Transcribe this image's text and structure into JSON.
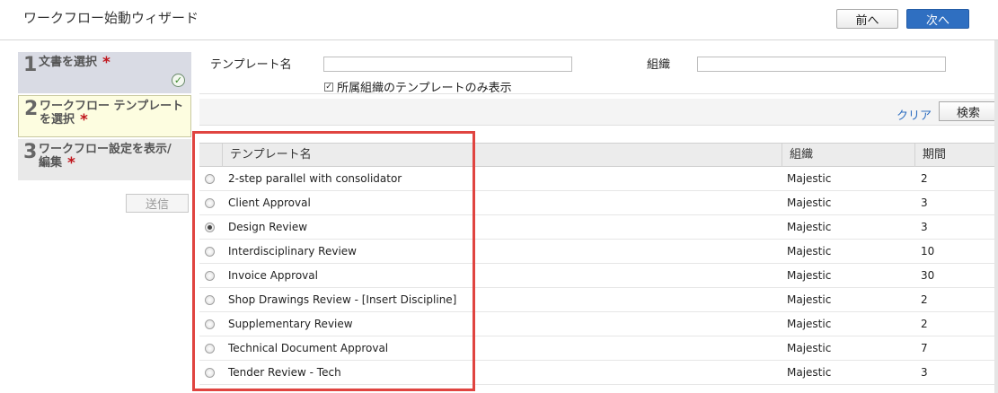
{
  "header": {
    "title": "ワークフロー始動ウィザード",
    "prev_label": "前へ",
    "next_label": "次へ"
  },
  "steps": [
    {
      "number": "1",
      "label_lines": [
        "文書を選択"
      ],
      "completed": true
    },
    {
      "number": "2",
      "label_lines": [
        "ワークフロー テンプレート",
        "を選択"
      ],
      "active": true
    },
    {
      "number": "3",
      "label_lines": [
        "ワークフロー設定を表示/",
        "編集"
      ]
    }
  ],
  "required_mark": "*",
  "send_label": "送信",
  "search": {
    "template_label": "テンプレート名",
    "template_value": "",
    "org_label": "組織",
    "org_value": "",
    "own_org_only_label": "所属組織のテンプレートのみ表示",
    "own_org_only_checked": true,
    "clear_label": "クリア",
    "search_label": "検索"
  },
  "table": {
    "columns": [
      "テンプレート名",
      "組織",
      "期間"
    ],
    "rows": [
      {
        "name": "2-step parallel with consolidator",
        "org": "Majestic",
        "period": "2",
        "selected": false
      },
      {
        "name": "Client Approval",
        "org": "Majestic",
        "period": "3",
        "selected": false
      },
      {
        "name": "Design Review",
        "org": "Majestic",
        "period": "3",
        "selected": true
      },
      {
        "name": "Interdisciplinary Review",
        "org": "Majestic",
        "period": "10",
        "selected": false
      },
      {
        "name": "Invoice Approval",
        "org": "Majestic",
        "period": "30",
        "selected": false
      },
      {
        "name": "Shop Drawings Review - [Insert Discipline]",
        "org": "Majestic",
        "period": "2",
        "selected": false
      },
      {
        "name": "Supplementary Review",
        "org": "Majestic",
        "period": "2",
        "selected": false
      },
      {
        "name": "Technical Document Approval",
        "org": "Majestic",
        "period": "7",
        "selected": false
      },
      {
        "name": "Tender Review - Tech",
        "org": "Majestic",
        "period": "3",
        "selected": false
      }
    ]
  },
  "colors": {
    "accent": "#2f6fc1",
    "required": "#c0141b",
    "highlight": "#e04440"
  }
}
